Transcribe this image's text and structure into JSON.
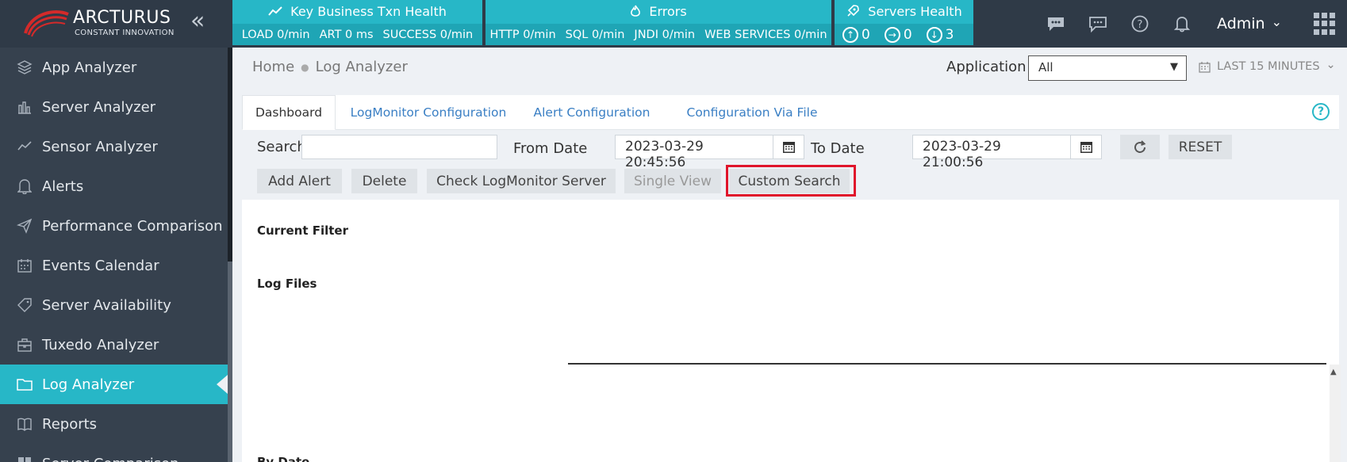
{
  "brand": {
    "name": "ARCTURUS",
    "tagline": "CONSTANT INNOVATION",
    "collapse_glyph": "«"
  },
  "health": {
    "txn": {
      "title": "Key Business Txn Health",
      "icon": "trend-line-icon",
      "load": "LOAD 0/min",
      "art": "ART 0 ms",
      "success": "SUCCESS 0/min"
    },
    "errors": {
      "title": "Errors",
      "icon": "flame-icon",
      "http": "HTTP 0/min",
      "sql": "SQL 0/min",
      "jndi": "JNDI 0/min",
      "ws": "WEB SERVICES 0/min"
    },
    "servers": {
      "title": "Servers Health",
      "icon": "rocket-icon",
      "up": "0",
      "right": "0",
      "down": "3"
    }
  },
  "user": {
    "name": "Admin",
    "caret": "⌄"
  },
  "sidebar": {
    "items": [
      {
        "label": "App Analyzer",
        "icon": "layers-icon"
      },
      {
        "label": "Server Analyzer",
        "icon": "bar-chart-icon"
      },
      {
        "label": "Sensor Analyzer",
        "icon": "trend-icon"
      },
      {
        "label": "Alerts",
        "icon": "bell-icon"
      },
      {
        "label": "Performance Comparison",
        "icon": "paper-plane-icon"
      },
      {
        "label": "Events Calendar",
        "icon": "calendar-icon"
      },
      {
        "label": "Server Availability",
        "icon": "tag-icon"
      },
      {
        "label": "Tuxedo Analyzer",
        "icon": "briefcase-icon"
      },
      {
        "label": "Log Analyzer",
        "icon": "folder-icon",
        "active": true
      },
      {
        "label": "Reports",
        "icon": "book-icon"
      },
      {
        "label": "Server Comparison",
        "icon": "grid-icon"
      }
    ]
  },
  "breadcrumb": {
    "home": "Home",
    "sep": "●",
    "current": "Log Analyzer"
  },
  "application": {
    "label": "Application",
    "value": "All",
    "caret": "▼"
  },
  "timerange": {
    "label": "LAST 15 MINUTES",
    "caret": "⌄"
  },
  "tabs": [
    "Dashboard",
    "LogMonitor Configuration",
    "Alert Configuration",
    "Configuration Via File"
  ],
  "help_glyph": "?",
  "filters": {
    "search_label": "Search",
    "search_value": "",
    "from_label": "From Date",
    "from_value": "2023-03-29 20:45:56",
    "to_label": "To Date",
    "to_value": "2023-03-29 21:00:56",
    "reset_label": "RESET"
  },
  "actions": {
    "add_alert": "Add Alert",
    "delete": "Delete",
    "check_server": "Check LogMonitor Server",
    "single_view": "Single View",
    "custom_search": "Custom Search"
  },
  "sections": {
    "current_filter": "Current Filter",
    "log_files": "Log Files",
    "cut_off": "By Date"
  },
  "colors": {
    "teal": "#27b7c7",
    "sidebar_bg": "#36414e",
    "highlight": "#e0152b"
  }
}
